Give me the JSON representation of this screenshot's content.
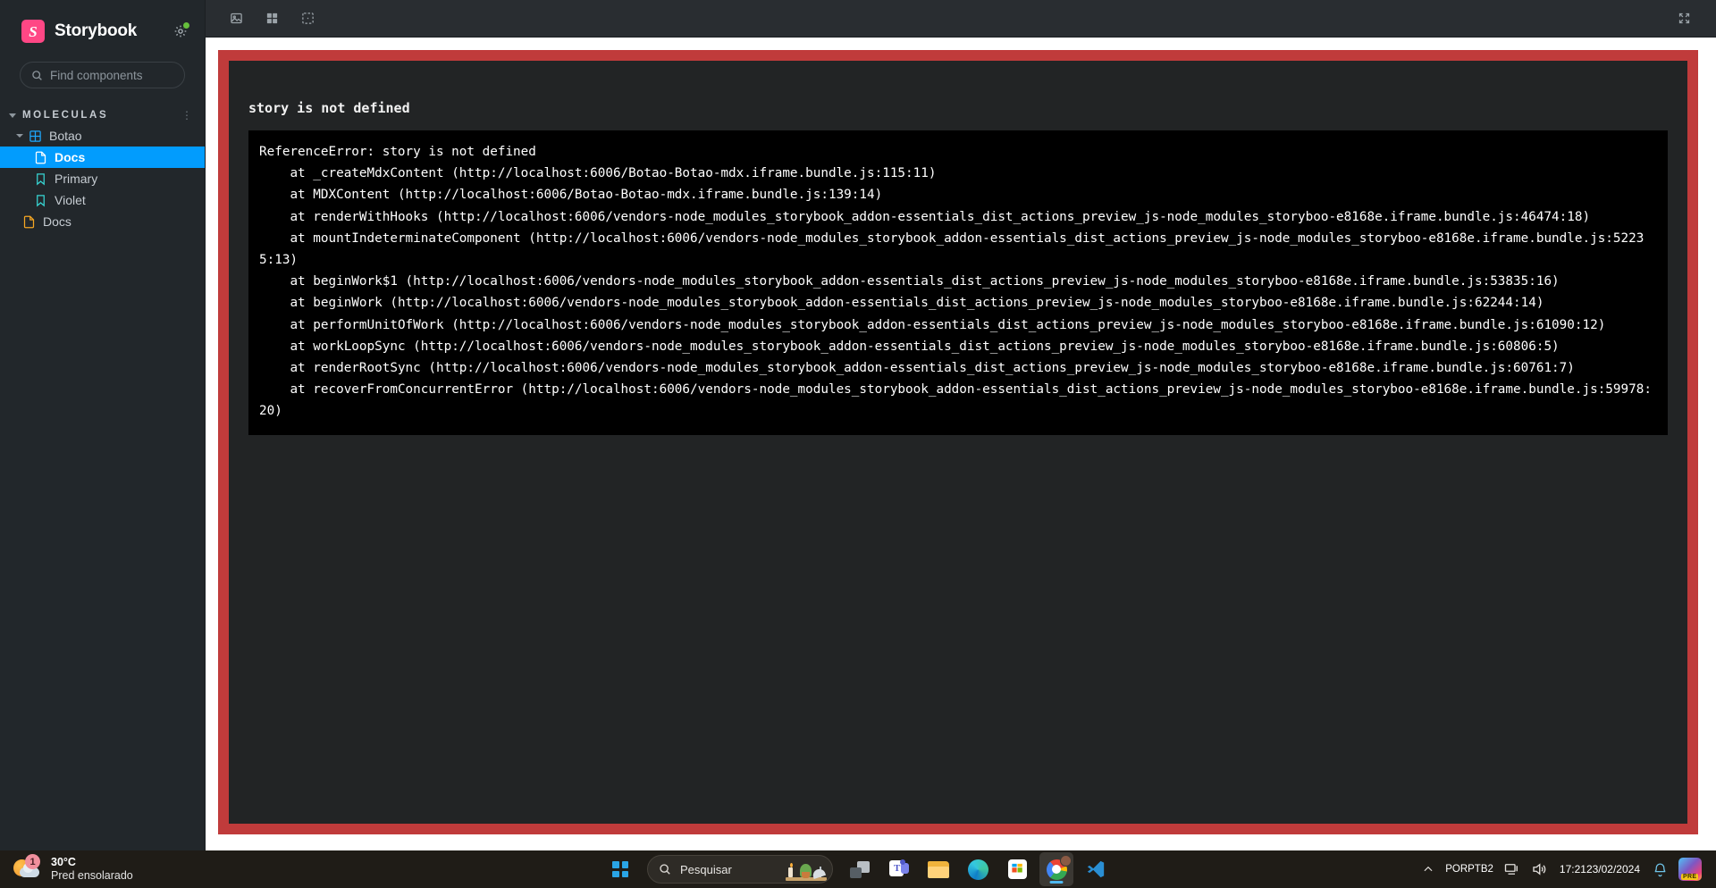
{
  "sidebar": {
    "brand": "Storybook",
    "logo_letter": "S",
    "brand_color": "#ff4785",
    "status_dot_color": "#66bf3c",
    "search": {
      "placeholder": "Find components",
      "value": "",
      "shortcut_key": "/"
    },
    "group": {
      "label": "MOLECULAS",
      "expanded": true
    },
    "items": [
      {
        "label": "Botao",
        "icon": "component-grid-icon",
        "level": 0,
        "type": "component",
        "expanded": true,
        "selected": false
      },
      {
        "label": "Docs",
        "icon": "document-icon",
        "level": 1,
        "type": "docs",
        "selected": true
      },
      {
        "label": "Primary",
        "icon": "bookmark-icon",
        "level": 1,
        "type": "story",
        "selected": false
      },
      {
        "label": "Violet",
        "icon": "bookmark-icon",
        "level": 1,
        "type": "story",
        "selected": false
      },
      {
        "label": "Docs",
        "icon": "document-icon",
        "level": 0,
        "type": "docs-root",
        "selected": false
      }
    ],
    "selected_color": "#029cfd"
  },
  "toolbar": {
    "buttons": [
      {
        "name": "backgrounds-icon",
        "title": "Backgrounds"
      },
      {
        "name": "grid-icon",
        "title": "Grid"
      },
      {
        "name": "measure-icon",
        "title": "Measure"
      }
    ],
    "fullscreen": {
      "name": "fullscreen-icon",
      "title": "Go full screen"
    }
  },
  "preview": {
    "border_color": "#c03b3b",
    "error_title": "story is not defined",
    "stack_trace": "ReferenceError: story is not defined\n    at _createMdxContent (http://localhost:6006/Botao-Botao-mdx.iframe.bundle.js:115:11)\n    at MDXContent (http://localhost:6006/Botao-Botao-mdx.iframe.bundle.js:139:14)\n    at renderWithHooks (http://localhost:6006/vendors-node_modules_storybook_addon-essentials_dist_actions_preview_js-node_modules_storyboo-e8168e.iframe.bundle.js:46474:18)\n    at mountIndeterminateComponent (http://localhost:6006/vendors-node_modules_storybook_addon-essentials_dist_actions_preview_js-node_modules_storyboo-e8168e.iframe.bundle.js:52235:13)\n    at beginWork$1 (http://localhost:6006/vendors-node_modules_storybook_addon-essentials_dist_actions_preview_js-node_modules_storyboo-e8168e.iframe.bundle.js:53835:16)\n    at beginWork (http://localhost:6006/vendors-node_modules_storybook_addon-essentials_dist_actions_preview_js-node_modules_storyboo-e8168e.iframe.bundle.js:62244:14)\n    at performUnitOfWork (http://localhost:6006/vendors-node_modules_storybook_addon-essentials_dist_actions_preview_js-node_modules_storyboo-e8168e.iframe.bundle.js:61090:12)\n    at workLoopSync (http://localhost:6006/vendors-node_modules_storybook_addon-essentials_dist_actions_preview_js-node_modules_storyboo-e8168e.iframe.bundle.js:60806:5)\n    at renderRootSync (http://localhost:6006/vendors-node_modules_storybook_addon-essentials_dist_actions_preview_js-node_modules_storyboo-e8168e.iframe.bundle.js:60761:7)\n    at recoverFromConcurrentError (http://localhost:6006/vendors-node_modules_storybook_addon-essentials_dist_actions_preview_js-node_modules_storyboo-e8168e.iframe.bundle.js:59978:20)"
  },
  "taskbar": {
    "weather": {
      "temperature": "30°C",
      "condition": "Pred ensolarado",
      "badge_count": "1"
    },
    "search": {
      "placeholder": "Pesquisar"
    },
    "apps": [
      {
        "name": "task-view-icon",
        "label": "Task View",
        "active": false
      },
      {
        "name": "microsoft-teams-icon",
        "label": "Microsoft Teams",
        "active": false
      },
      {
        "name": "file-explorer-icon",
        "label": "File Explorer",
        "active": false
      },
      {
        "name": "microsoft-edge-icon",
        "label": "Microsoft Edge",
        "active": false
      },
      {
        "name": "microsoft-store-icon",
        "label": "Microsoft Store",
        "active": false
      },
      {
        "name": "google-chrome-icon",
        "label": "Google Chrome",
        "active": true
      },
      {
        "name": "vs-code-icon",
        "label": "Visual Studio Code",
        "active": false
      }
    ],
    "tray": {
      "language_line1": "POR",
      "language_line2": "PTB2",
      "time": "17:21",
      "date": "23/02/2024",
      "copilot_badge": "PRE"
    }
  }
}
